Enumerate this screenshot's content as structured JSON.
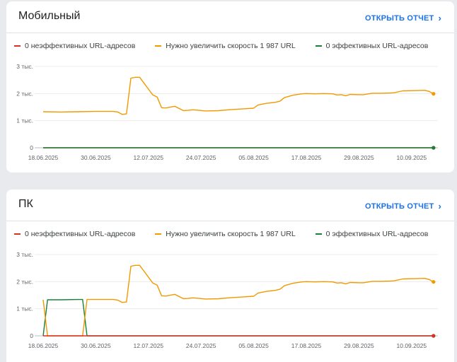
{
  "cards": [
    {
      "title": "Мобильный",
      "open_report_label": "ОТКРЫТЬ ОТЧЕТ",
      "legend": [
        {
          "label": "0 неэффективных URL-адресов",
          "color": "#d93025"
        },
        {
          "label": "Нужно увеличить скорость 1 987 URL",
          "color": "#f29900"
        },
        {
          "label": "0 эффективных URL-адресов",
          "color": "#188038"
        }
      ]
    },
    {
      "title": "ПК",
      "open_report_label": "ОТКРЫТЬ ОТЧЕТ",
      "legend": [
        {
          "label": "0 неэффективных URL-адресов",
          "color": "#d93025"
        },
        {
          "label": "Нужно увеличить скорость 1 987 URL",
          "color": "#f29900"
        },
        {
          "label": "0 эффективных URL-адресов",
          "color": "#188038"
        }
      ]
    }
  ],
  "chart_data": [
    {
      "type": "line",
      "y_ticks": [
        "0",
        "1 тыс.",
        "2 тыс.",
        "3 тыс."
      ],
      "ylim": [
        0,
        3000
      ],
      "x_tick_labels": [
        "18.06.2025",
        "30.06.2025",
        "12.07.2025",
        "24.07.2025",
        "05.08.2025",
        "17.08.2025",
        "29.08.2025",
        "10.09.2025"
      ],
      "x_start": "2025-06-18",
      "x_step_days": 12,
      "x_days_total": 88,
      "grid": true,
      "series": [
        {
          "name": "Нужно увеличить скорость 1 987 URL",
          "color": "#f29900",
          "points": [
            [
              0,
              1330
            ],
            [
              4,
              1320
            ],
            [
              8,
              1330
            ],
            [
              12,
              1340
            ],
            [
              16,
              1340
            ],
            [
              17,
              1320
            ],
            [
              18,
              1230
            ],
            [
              19,
              1250
            ],
            [
              20,
              2570
            ],
            [
              21,
              2600
            ],
            [
              22,
              2600
            ],
            [
              25,
              1950
            ],
            [
              26,
              1870
            ],
            [
              27,
              1480
            ],
            [
              28,
              1470
            ],
            [
              30,
              1530
            ],
            [
              32,
              1370
            ],
            [
              33,
              1380
            ],
            [
              34,
              1400
            ],
            [
              35,
              1390
            ],
            [
              37,
              1360
            ],
            [
              40,
              1370
            ],
            [
              43,
              1410
            ],
            [
              46,
              1440
            ],
            [
              48,
              1460
            ],
            [
              49,
              1580
            ],
            [
              51,
              1640
            ],
            [
              53,
              1680
            ],
            [
              54,
              1720
            ],
            [
              55,
              1850
            ],
            [
              57,
              1940
            ],
            [
              59,
              1990
            ],
            [
              60,
              2000
            ],
            [
              62,
              1990
            ],
            [
              64,
              2000
            ],
            [
              66,
              1990
            ],
            [
              67,
              1950
            ],
            [
              68,
              1960
            ],
            [
              69,
              1920
            ],
            [
              70,
              1970
            ],
            [
              72,
              1960
            ],
            [
              73,
              1960
            ],
            [
              75,
              2010
            ],
            [
              77,
              2010
            ],
            [
              79,
              2020
            ],
            [
              80,
              2030
            ],
            [
              82,
              2100
            ],
            [
              85,
              2110
            ],
            [
              87,
              2120
            ],
            [
              88,
              2080
            ],
            [
              89,
              1990
            ]
          ]
        },
        {
          "name": "0 неэффективных URL-адресов",
          "color": "#d93025",
          "points": [
            [
              0,
              0
            ],
            [
              89,
              0
            ]
          ]
        },
        {
          "name": "0 эффективных URL-адресов",
          "color": "#188038",
          "points": [
            [
              0,
              0
            ],
            [
              89,
              0
            ]
          ]
        }
      ]
    },
    {
      "type": "line",
      "y_ticks": [
        "0",
        "1 тыс.",
        "2 тыс.",
        "3 тыс."
      ],
      "ylim": [
        0,
        3000
      ],
      "x_tick_labels": [
        "18.06.2025",
        "30.06.2025",
        "12.07.2025",
        "24.07.2025",
        "05.08.2025",
        "17.08.2025",
        "29.08.2025",
        "10.09.2025"
      ],
      "x_start": "2025-06-18",
      "x_step_days": 12,
      "x_days_total": 88,
      "grid": true,
      "series": [
        {
          "name": "0 эффективных URL-адресов",
          "color": "#188038",
          "points": [
            [
              0,
              0
            ],
            [
              1,
              1330
            ],
            [
              4,
              1330
            ],
            [
              8,
              1340
            ],
            [
              9,
              1340
            ],
            [
              10,
              0
            ],
            [
              89,
              0
            ]
          ]
        },
        {
          "name": "Нужно увеличить скорость 1 987 URL",
          "color": "#f29900",
          "points": [
            [
              0,
              1330
            ],
            [
              1,
              0
            ],
            [
              9,
              0
            ],
            [
              10,
              1340
            ],
            [
              12,
              1340
            ],
            [
              16,
              1340
            ],
            [
              17,
              1320
            ],
            [
              18,
              1230
            ],
            [
              19,
              1250
            ],
            [
              20,
              2570
            ],
            [
              21,
              2600
            ],
            [
              22,
              2600
            ],
            [
              25,
              1950
            ],
            [
              26,
              1870
            ],
            [
              27,
              1480
            ],
            [
              28,
              1470
            ],
            [
              30,
              1530
            ],
            [
              32,
              1370
            ],
            [
              33,
              1380
            ],
            [
              34,
              1400
            ],
            [
              35,
              1390
            ],
            [
              37,
              1360
            ],
            [
              40,
              1370
            ],
            [
              43,
              1410
            ],
            [
              46,
              1440
            ],
            [
              48,
              1460
            ],
            [
              49,
              1580
            ],
            [
              51,
              1640
            ],
            [
              53,
              1680
            ],
            [
              54,
              1720
            ],
            [
              55,
              1850
            ],
            [
              57,
              1940
            ],
            [
              59,
              1990
            ],
            [
              60,
              2000
            ],
            [
              62,
              1990
            ],
            [
              64,
              2000
            ],
            [
              66,
              1990
            ],
            [
              67,
              1950
            ],
            [
              68,
              1960
            ],
            [
              69,
              1920
            ],
            [
              70,
              1970
            ],
            [
              72,
              1960
            ],
            [
              73,
              1960
            ],
            [
              75,
              2010
            ],
            [
              77,
              2010
            ],
            [
              79,
              2020
            ],
            [
              80,
              2030
            ],
            [
              82,
              2100
            ],
            [
              85,
              2110
            ],
            [
              87,
              2120
            ],
            [
              88,
              2080
            ],
            [
              89,
              1990
            ]
          ]
        },
        {
          "name": "0 неэффективных URL-адресов",
          "color": "#d93025",
          "points": [
            [
              0,
              0
            ],
            [
              89,
              0
            ]
          ]
        }
      ]
    }
  ]
}
